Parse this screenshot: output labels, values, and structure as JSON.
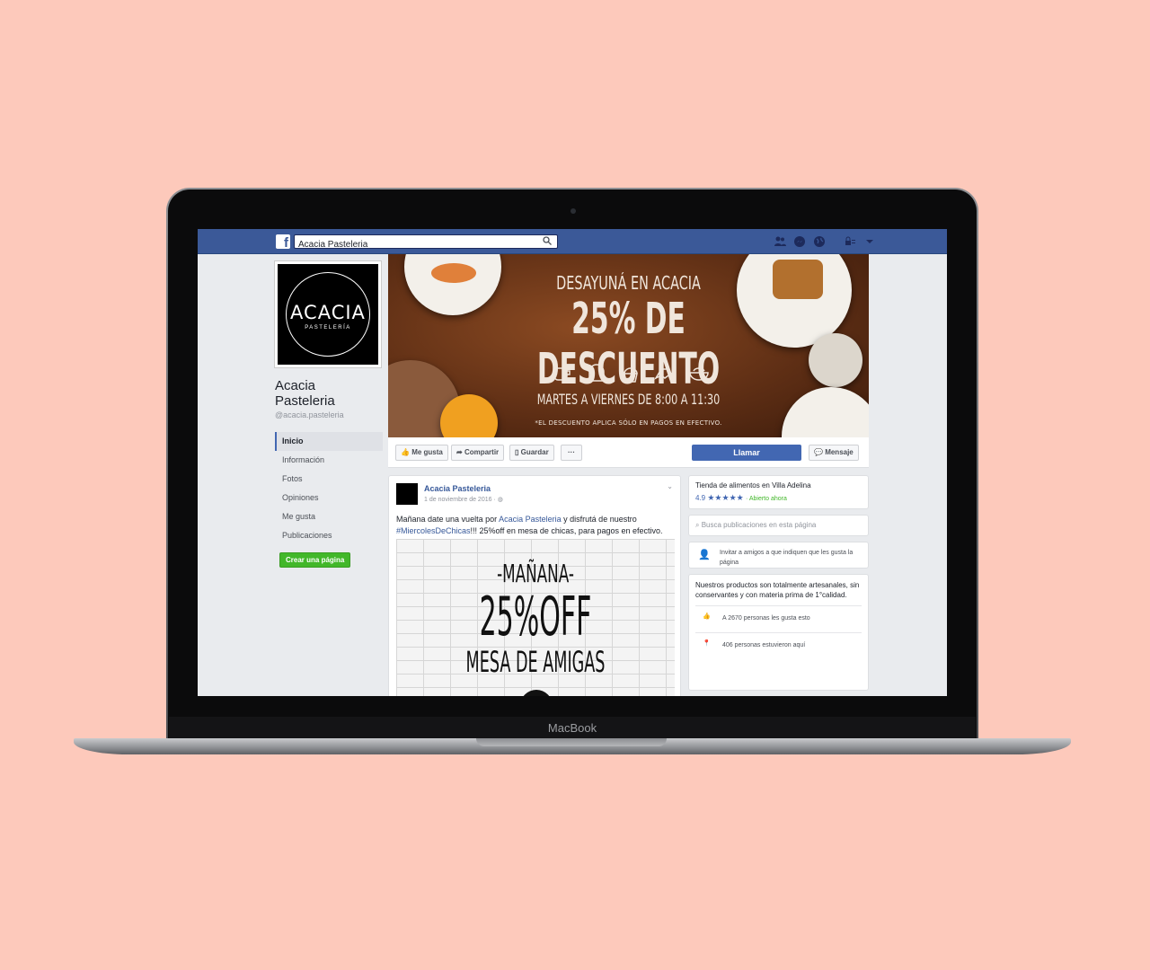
{
  "browser": {
    "search_value": "Acacia Pasteleria"
  },
  "laptop": {
    "brand": "MacBook"
  },
  "page": {
    "avatar_title": "ACACIA",
    "avatar_subtitle": "PASTELERÍA",
    "name": "Acacia Pasteleria",
    "handle": "@acacia.pasteleria"
  },
  "nav": [
    "Inicio",
    "Información",
    "Fotos",
    "Opiniones",
    "Me gusta",
    "Publicaciones"
  ],
  "create_page": "Crear una página",
  "cover": {
    "line1": "DESAYUNÁ EN ACACIA",
    "line2": "25% DE DESCUENTO",
    "line3": "MARTES A VIERNES DE 8:00 A 11:30",
    "line4": "*EL DESCUENTO APLICA SÓLO EN PAGOS EN EFECTIVO."
  },
  "actions": {
    "like": "Me gusta",
    "share": "Compartir",
    "save": "Guardar",
    "more": "···",
    "call": "Llamar",
    "message": "Mensaje"
  },
  "post": {
    "author": "Acacia Pasteleria",
    "date": "1 de noviembre de 2016 ·",
    "text_1": "Mañana date una vuelta por",
    "text_link": "Acacia Pasteleria",
    "text_2": "y disfrutá de nuestro",
    "hashtag": "#MiercolesDeChicas",
    "text_3": "!!! 25%off en mesa de chicas, para pagos en efectivo.",
    "image_line1": "-MAÑANA-",
    "image_line2": "25%OFF",
    "image_line3": "MESA DE AMIGAS"
  },
  "sidebar": {
    "category": "Tienda de alimentos en Villa Adelina",
    "rating": "4.9",
    "stars": "★★★★★",
    "open": "· Abierto ahora",
    "search_placeholder": "Busca publicaciones en esta página",
    "invite": "Invitar a amigos a que indiquen que les gusta la página",
    "about": "Nuestros productos son totalmente artesanales, sin conservantes y con materia prima de 1°calidad.",
    "likes": "A 2670 personas les gusta esto",
    "checkins": "406 personas estuvieron aquí"
  },
  "colors": {
    "background": "#fdc9bb",
    "facebook_blue": "#3b5998",
    "button_blue": "#4267b2",
    "green": "#42b72a"
  }
}
